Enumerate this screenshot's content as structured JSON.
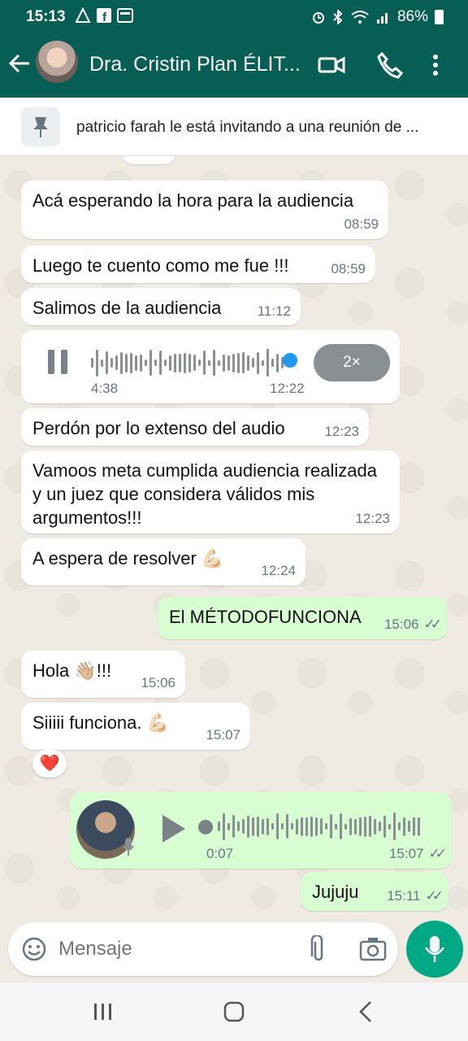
{
  "status": {
    "time": "15:13",
    "battery": "86%"
  },
  "header": {
    "back_icon": "arrow-left",
    "contact_name": "Dra. Cristin Plan ÉLIT...",
    "icons": [
      "video-call-icon",
      "phone-icon",
      "more-vert-icon"
    ]
  },
  "pinned": {
    "text": "patricio farah le está invitando a una reunión de ..."
  },
  "messages": [
    {
      "dir": "in",
      "text": "Acá esperando la hora para la audiencia",
      "time": "08:59"
    },
    {
      "dir": "in",
      "text": "Luego te cuento como me fue !!!",
      "time": "08:59"
    },
    {
      "dir": "in",
      "text": "Salimos de la audiencia",
      "time": "11:12"
    },
    {
      "dir": "in",
      "type": "audio",
      "duration": "4:38",
      "time": "12:22",
      "speed": "2×",
      "progress": 0.95
    },
    {
      "dir": "in",
      "text": "Perdón por lo extenso del audio",
      "time": "12:23"
    },
    {
      "dir": "in",
      "text": "Vamoos meta cumplida audiencia realizada y un juez que considera válidos mis argumentos!!!",
      "time": "12:23"
    },
    {
      "dir": "in",
      "text": "A espera de resolver 💪🏻",
      "time": "12:24"
    },
    {
      "dir": "out",
      "text": "El MÉTODOFUNCIONA",
      "time": "15:06"
    },
    {
      "dir": "in",
      "text": "Hola 👋🏼!!!",
      "time": "15:06"
    },
    {
      "dir": "in",
      "text": "Siiiii funciona. 💪🏻",
      "time": "15:07",
      "reaction": "❤️"
    },
    {
      "dir": "out",
      "type": "audio",
      "duration": "0:07",
      "time": "15:07",
      "progress": 0.0
    },
    {
      "dir": "out",
      "text": "Jujuju",
      "time": "15:11"
    }
  ],
  "input": {
    "placeholder": "Mensaje"
  },
  "colors": {
    "header": "#075e54",
    "outgoing_bubble": "#d9fdd3",
    "incoming_bubble": "#ffffff",
    "accent": "#00a884",
    "audio_progress_dot": "#2196f3"
  }
}
